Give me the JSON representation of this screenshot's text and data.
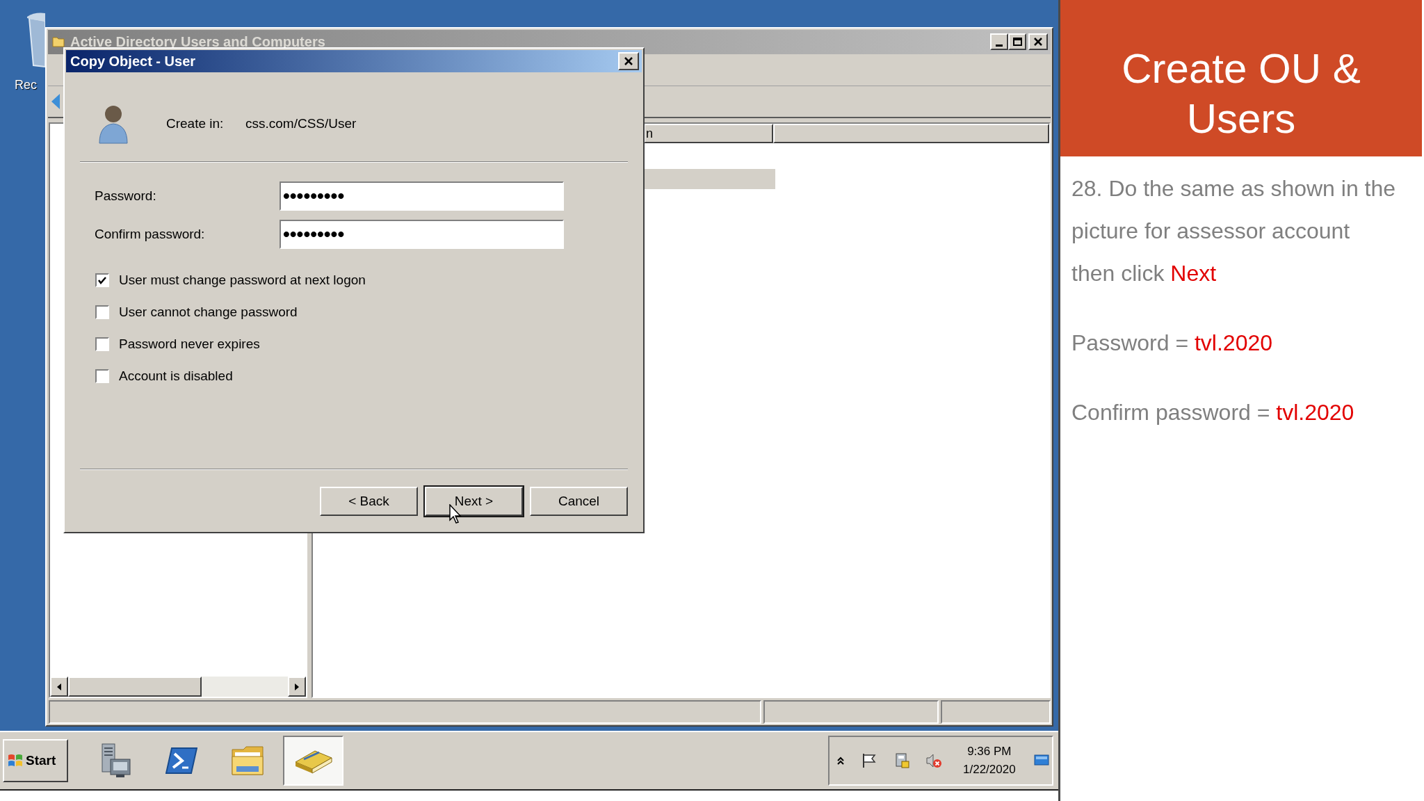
{
  "desktop": {
    "icons": [
      {
        "label": "Rec"
      }
    ]
  },
  "background_window": {
    "title": "Active Directory Users and Computers",
    "list": {
      "columns": [
        {
          "label": "n"
        }
      ],
      "rows": [
        {
          "selected": true
        }
      ]
    }
  },
  "dialog": {
    "title": "Copy Object - User",
    "create_in": {
      "label": "Create in:",
      "value": "css.com/CSS/User"
    },
    "fields": [
      {
        "label": "Password:",
        "value": "•••••••••"
      },
      {
        "label": "Confirm password:",
        "value": "•••••••••"
      }
    ],
    "options": [
      {
        "label": "User must change password at next logon",
        "checked": true
      },
      {
        "label": "User cannot change password",
        "checked": false
      },
      {
        "label": "Password never expires",
        "checked": false
      },
      {
        "label": "Account is disabled",
        "checked": false
      }
    ],
    "buttons": [
      {
        "label": "< Back",
        "default": false
      },
      {
        "label": "Next >",
        "default": true
      },
      {
        "label": "Cancel",
        "default": false
      }
    ]
  },
  "taskbar": {
    "start": "Start",
    "apps": [
      {
        "kind": "server",
        "selected": false
      },
      {
        "kind": "shell",
        "selected": false
      },
      {
        "kind": "explorer",
        "selected": false
      },
      {
        "kind": "directory",
        "selected": true
      }
    ],
    "clock": {
      "time": "9:36 PM",
      "date": "1/22/2020"
    }
  },
  "slide": {
    "title": "Create OU & Users",
    "paragraphs": [
      {
        "text": "28. Do the same as shown in the\npicture for assessor account\nthen click ",
        "emphasis": "Next"
      },
      {
        "text": "Password = ",
        "emphasis": "tvl.2020"
      },
      {
        "text": "Confirm password = ",
        "emphasis": "tvl.2020"
      }
    ]
  }
}
